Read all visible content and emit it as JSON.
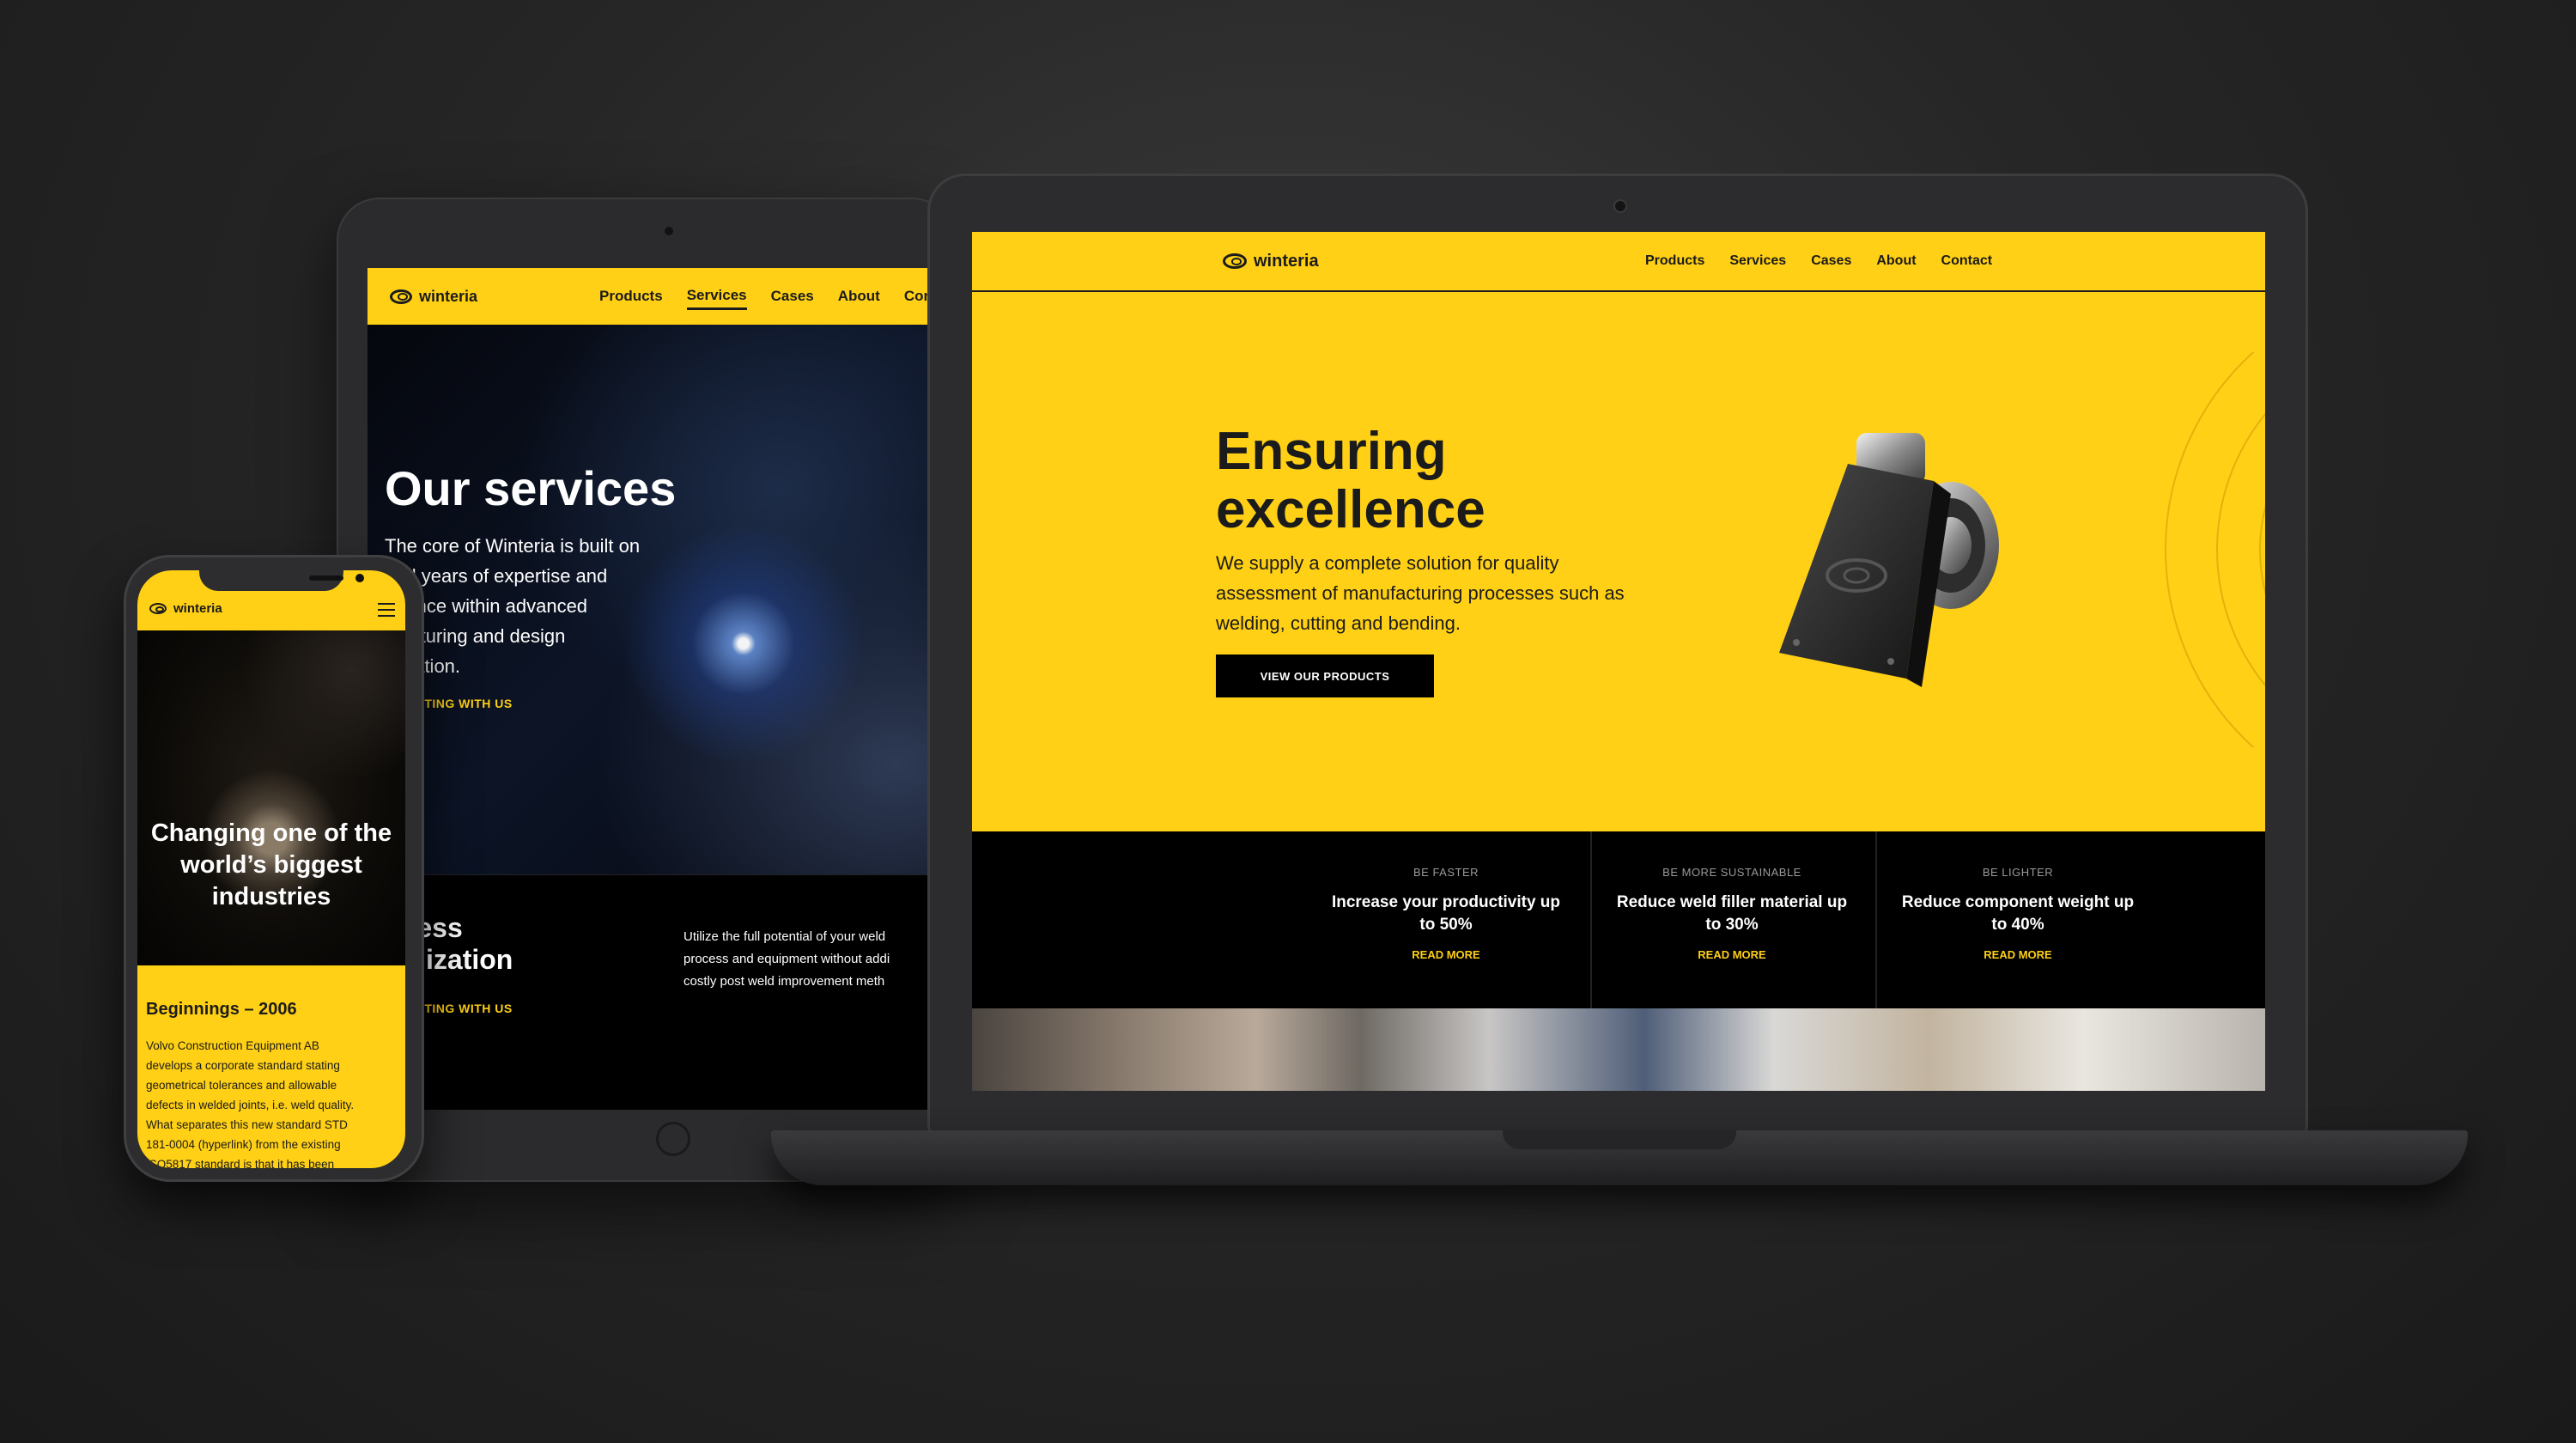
{
  "brand": {
    "name": "winteria",
    "accent_color": "#ffd015",
    "text_color": "#1b1b1b",
    "dark_color": "#000000",
    "logo_icon": "eye-logo-icon"
  },
  "tablet": {
    "nav": {
      "brand": "winteria",
      "links": [
        "Products",
        "Services",
        "Cases",
        "About",
        "Con"
      ],
      "active": "Services"
    },
    "hero": {
      "title": "Our services",
      "text": "The core of Winteria is built on\neral years of expertise and\nerience within advanced\nufacturing and design\nmization.",
      "link": "A MEETING WITH US"
    },
    "section": {
      "title": "ocess\ntimization",
      "link": "A MEETING WITH US",
      "text": "Utilize the full potential of your weld\nprocess and equipment without addi\ncostly post weld improvement meth"
    }
  },
  "phone": {
    "nav": {
      "brand": "winteria",
      "menu_icon": "hamburger-menu-icon"
    },
    "hero": {
      "title": "Changing one of the\nworld’s biggest\nindustries"
    },
    "card": {
      "title": "Beginnings – 2006",
      "text": "Volvo Construction Equipment AB\ndevelops a corporate standard stating\ngeometrical tolerances and allowable\ndefects in welded joints, i.e. weld quality.\nWhat separates this new standard STD\n181-0004 (hyperlink) from the existing\nISO5817 standard is that it has been"
    }
  },
  "laptop": {
    "nav": {
      "brand": "winteria",
      "links": [
        "Products",
        "Services",
        "Cases",
        "About",
        "Contact"
      ]
    },
    "hero": {
      "title": "Ensuring\nexcellence",
      "text": "We supply a complete solution for quality\nassessment of manufacturing processes such as\nwelding, cutting and bending.",
      "button": "VIEW OUR PRODUCTS"
    },
    "features": [
      {
        "kicker": "BE FASTER",
        "title": "Increase your productivity up\nto 50%",
        "link": "READ MORE"
      },
      {
        "kicker": "BE MORE SUSTAINABLE",
        "title": "Reduce weld filler material up\nto 30%",
        "link": "READ MORE"
      },
      {
        "kicker": "BE LIGHTER",
        "title": "Reduce component weight up\nto 40%",
        "link": "READ MORE"
      }
    ]
  }
}
